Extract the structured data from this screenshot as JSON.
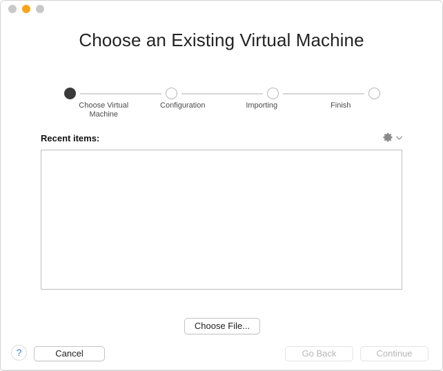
{
  "window": {
    "traffic_lights": [
      {
        "name": "close",
        "color": "#c8c8c8"
      },
      {
        "name": "minimize",
        "color": "#f7a41d"
      },
      {
        "name": "zoom",
        "color": "#c8c8c8"
      }
    ]
  },
  "header": {
    "title": "Choose an Existing Virtual Machine"
  },
  "steps": {
    "items": [
      {
        "label": "Choose Virtual\nMachine",
        "state": "done"
      },
      {
        "label": "Configuration",
        "state": "todo"
      },
      {
        "label": "Importing",
        "state": "todo"
      },
      {
        "label": "Finish",
        "state": "todo"
      }
    ]
  },
  "recent": {
    "label": "Recent items:",
    "gear_icon": "gear-icon",
    "chevron_icon": "chevron-down-icon",
    "items": []
  },
  "actions": {
    "choose_file_label": "Choose File...",
    "help_label": "?",
    "cancel_label": "Cancel",
    "go_back_label": "Go Back",
    "continue_label": "Continue"
  },
  "colors": {
    "accent_blue": "#2f7fe0",
    "step_done": "#3a3a3a",
    "step_todo_border": "#b6b6b6",
    "connector": "#d6d6d6",
    "disabled_text": "#b7b7b7"
  }
}
